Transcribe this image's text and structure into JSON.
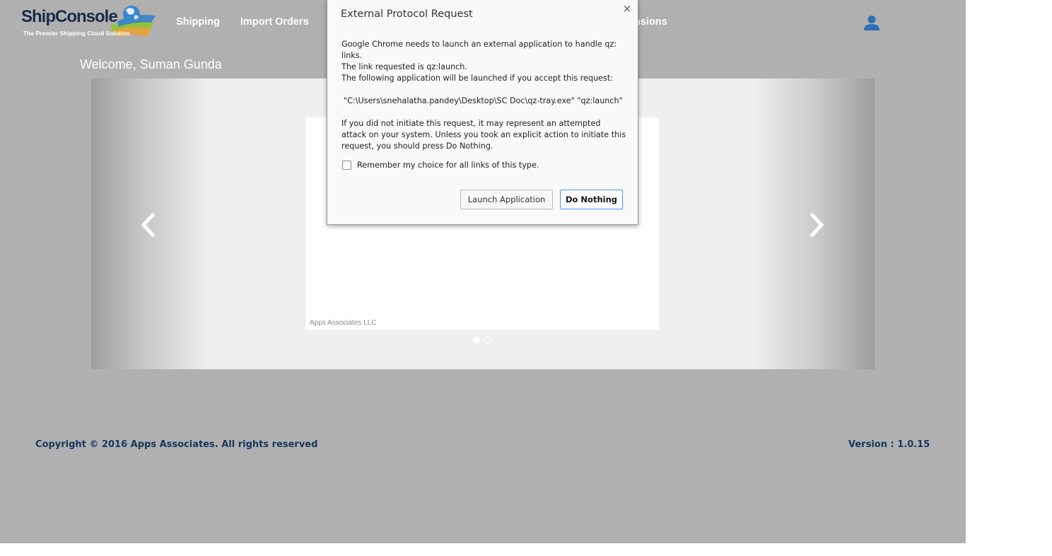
{
  "header": {
    "logo_text": "ShipConsole",
    "logo_tagline": "The Premier Shipping Cloud Solution",
    "nav": [
      {
        "label": "Shipping"
      },
      {
        "label": "Import Orders"
      },
      {
        "label": "nsions"
      }
    ],
    "user_icon": "user-icon"
  },
  "welcome": "Welcome, Suman Gunda",
  "carousel": {
    "slide_caption": "Apps Associates LLC",
    "prev_icon": "chevron-left-icon",
    "next_icon": "chevron-right-icon",
    "active_index": 1,
    "slide_count": 2
  },
  "footer": {
    "copyright": "Copyright © 2016 Apps Associates. All rights reserved",
    "version": "Version : 1.0.15"
  },
  "dialog": {
    "title": "External Protocol Request",
    "close_icon": "close-icon",
    "close_glyph": "×",
    "p1_line1": "Google Chrome needs to launch an external application to handle qz: links.",
    "p1_line2": "The link requested is qz:launch.",
    "p2": "The following application will be launched if you accept this request:",
    "command": "\"C:\\Users\\snehalatha.pandey\\Desktop\\SC Doc\\qz-tray.exe\" \"qz:launch\"",
    "warning": "If you did not initiate this request, it may represent an attempted attack on your system. Unless you took an explicit action to initiate this request, you should press Do Nothing.",
    "remember_label": "Remember my choice for all links of this type.",
    "remember_checked": false,
    "launch_label": "Launch Application",
    "nothing_label": "Do Nothing"
  },
  "colors": {
    "page_overlay": "#b0b0b0",
    "footer_text": "#17375e",
    "user_icon": "#2f6fb6",
    "primary_button_border": "#4d90fe"
  }
}
